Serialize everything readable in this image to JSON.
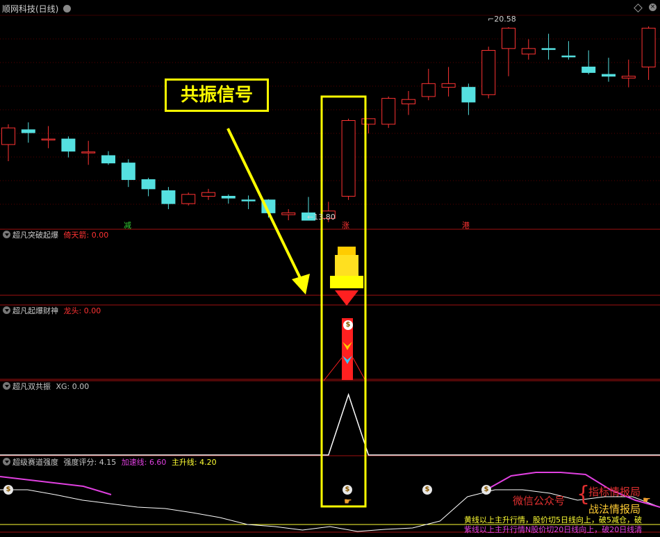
{
  "window": {
    "title": "顺网科技(日线)"
  },
  "callout": {
    "text": "共振信号"
  },
  "price_chart": {
    "high_label": "20.58",
    "low_label": "13.80",
    "markers": [
      {
        "text": "减",
        "color": "#33cc33"
      },
      {
        "text": "涨",
        "color": "#ff3333"
      },
      {
        "text": "港",
        "color": "#ff3333"
      }
    ]
  },
  "panels": [
    {
      "name": "超凡突破起爆",
      "field_label": "倚天箭:",
      "field_value": "0.00",
      "field_color": "#ff3333"
    },
    {
      "name": "超凡起爆财神",
      "field_label": "龙头:",
      "field_value": "0.00",
      "field_color": "#ff3333"
    },
    {
      "name": "超凡双共振",
      "field_label": "XG:",
      "field_value": "0.00",
      "field_color": "#cccccc"
    },
    {
      "name": "超级赛道强度",
      "field_label": "强度评分:",
      "field_value": "4.15",
      "field_color": "#cccccc",
      "extra": [
        {
          "label": "加速线:",
          "value": "6.60",
          "color": "#e040e0"
        },
        {
          "label": "主升线:",
          "value": "4.20",
          "color": "#ffff33"
        }
      ]
    }
  ],
  "watermark": {
    "prefix": "微信公众号",
    "line1": "指标情报局",
    "line2": "战法情报局"
  },
  "notes": {
    "line1": "黄线以上主升行情，股价切5日线向上，破5减仓，破",
    "line2": "紫线以上主升行情N股价切20日线向上，破20日线清"
  },
  "colors": {
    "up": "#ff3333",
    "down": "#55e0e0",
    "highlight": "#ffff00"
  },
  "chart_data": {
    "type": "candlestick",
    "title": "顺网科技(日线)",
    "candles": [
      {
        "o": 17.4,
        "h": 17.95,
        "l": 16.95,
        "c": 17.85
      },
      {
        "o": 17.8,
        "h": 18.0,
        "l": 17.45,
        "c": 17.72
      },
      {
        "o": 17.55,
        "h": 17.9,
        "l": 17.3,
        "c": 17.55
      },
      {
        "o": 17.55,
        "h": 17.62,
        "l": 17.05,
        "c": 17.22
      },
      {
        "o": 17.2,
        "h": 17.5,
        "l": 16.85,
        "c": 17.2
      },
      {
        "o": 17.1,
        "h": 17.22,
        "l": 16.85,
        "c": 16.9
      },
      {
        "o": 16.9,
        "h": 17.0,
        "l": 16.25,
        "c": 16.45
      },
      {
        "o": 16.45,
        "h": 16.5,
        "l": 16.0,
        "c": 16.2
      },
      {
        "o": 16.15,
        "h": 16.25,
        "l": 15.65,
        "c": 15.8
      },
      {
        "o": 15.8,
        "h": 16.1,
        "l": 15.75,
        "c": 16.05
      },
      {
        "o": 16.0,
        "h": 16.2,
        "l": 15.9,
        "c": 16.1
      },
      {
        "o": 16.0,
        "h": 16.05,
        "l": 15.8,
        "c": 15.95
      },
      {
        "o": 15.9,
        "h": 16.02,
        "l": 15.65,
        "c": 15.88
      },
      {
        "o": 15.9,
        "h": 15.92,
        "l": 15.42,
        "c": 15.55
      },
      {
        "o": 15.5,
        "h": 15.65,
        "l": 15.35,
        "c": 15.55
      },
      {
        "o": 15.55,
        "h": 15.98,
        "l": 15.4,
        "c": 15.35
      },
      {
        "o": 15.4,
        "h": 15.85,
        "l": 15.3,
        "c": 15.6
      },
      {
        "o": 16.0,
        "h": 18.1,
        "l": 15.9,
        "c": 18.05
      },
      {
        "o": 17.95,
        "h": 18.1,
        "l": 17.7,
        "c": 18.1
      },
      {
        "o": 17.95,
        "h": 18.7,
        "l": 17.85,
        "c": 18.65
      },
      {
        "o": 18.5,
        "h": 18.85,
        "l": 18.2,
        "c": 18.62
      },
      {
        "o": 18.7,
        "h": 19.45,
        "l": 18.6,
        "c": 19.05
      },
      {
        "o": 18.95,
        "h": 19.5,
        "l": 18.7,
        "c": 19.05
      },
      {
        "o": 18.95,
        "h": 19.05,
        "l": 18.2,
        "c": 18.55
      },
      {
        "o": 18.75,
        "h": 20.05,
        "l": 18.65,
        "c": 19.95
      },
      {
        "o": 20.0,
        "h": 20.58,
        "l": 19.25,
        "c": 20.55
      },
      {
        "o": 19.85,
        "h": 20.25,
        "l": 19.7,
        "c": 20.0
      },
      {
        "o": 20.0,
        "h": 20.4,
        "l": 19.7,
        "c": 19.98
      },
      {
        "o": 19.8,
        "h": 20.2,
        "l": 19.7,
        "c": 19.78
      },
      {
        "o": 19.5,
        "h": 19.95,
        "l": 19.3,
        "c": 19.35
      },
      {
        "o": 19.3,
        "h": 19.75,
        "l": 19.1,
        "c": 19.25
      },
      {
        "o": 19.2,
        "h": 19.7,
        "l": 18.95,
        "c": 19.25
      },
      {
        "o": 19.5,
        "h": 20.6,
        "l": 19.15,
        "c": 20.55
      }
    ],
    "high_annotation": 20.58,
    "low_annotation": 13.8,
    "resonance_series": [
      {
        "x": 16,
        "y": 0
      },
      {
        "x": 17,
        "y": 1
      },
      {
        "x": 18,
        "y": 0
      }
    ],
    "strength_series": {
      "white": [
        0.55,
        0.55,
        0.48,
        0.4,
        0.35,
        0.3,
        0.28,
        0.22,
        0.15,
        0.05,
        0.02,
        -0.03,
        0.02,
        -0.05,
        -0.02,
        0.0,
        0.1,
        0.45,
        0.55,
        0.55,
        0.5,
        0.4,
        0.45,
        0.45,
        0.3
      ],
      "magenta": [
        0.3,
        0.5,
        0.55,
        0.55,
        0.52,
        0.3,
        0.15,
        0.05
      ],
      "levels": {
        "yellow": 0.05,
        "magenta": 0.18
      }
    }
  }
}
